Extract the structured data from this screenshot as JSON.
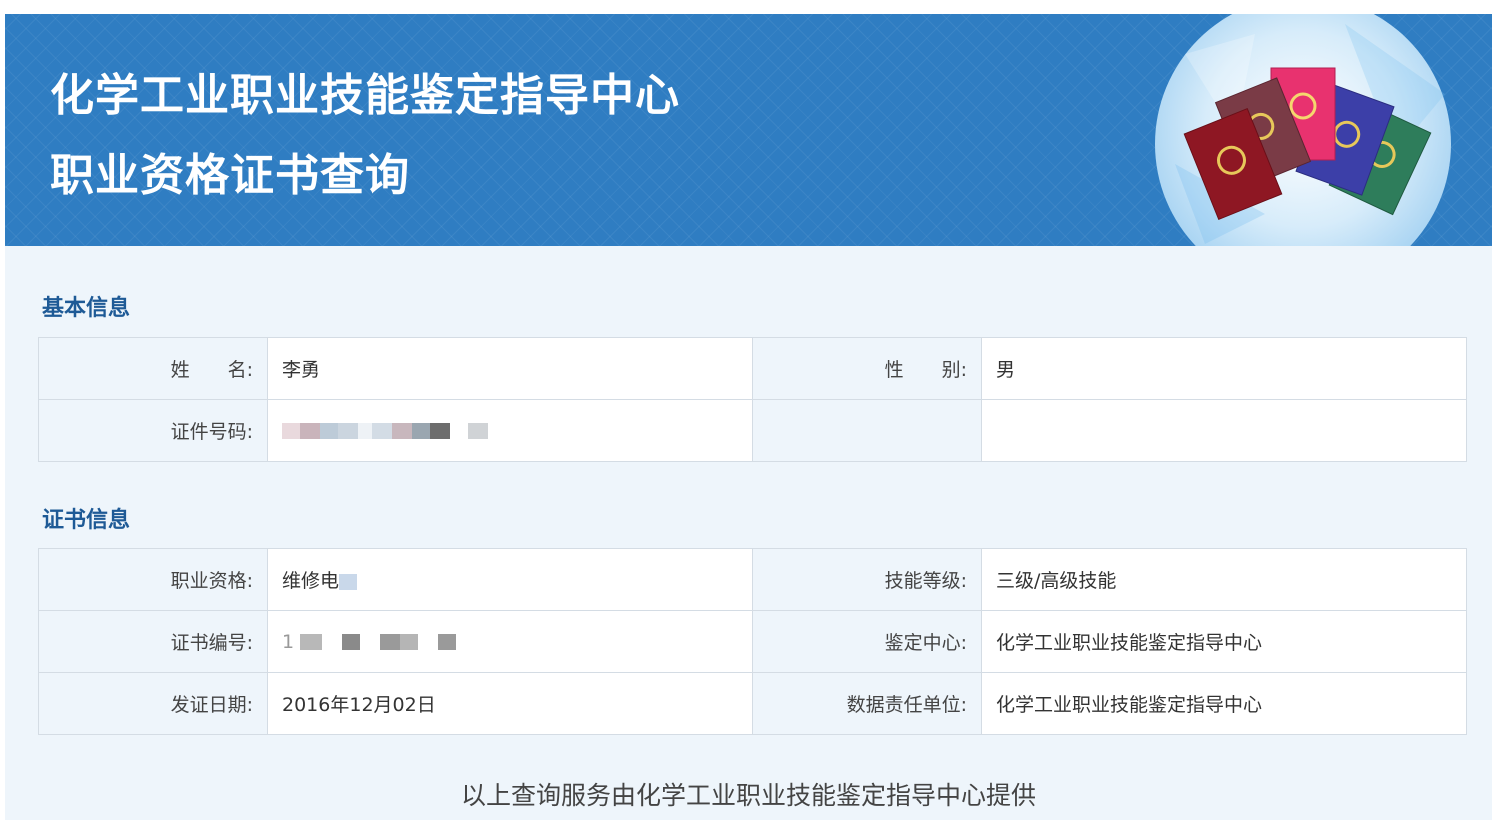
{
  "banner": {
    "title": "化学工业职业技能鉴定指导中心",
    "subtitle": "职业资格证书查询",
    "art_icon": "certificate-books-icon"
  },
  "basic": {
    "section_title": "基本信息",
    "name_label": "姓　　名:",
    "name_value": "李勇",
    "gender_label": "性　　别:",
    "gender_value": "男",
    "id_label": "证件号码:",
    "id_value": ""
  },
  "cert": {
    "section_title": "证书信息",
    "qualification_label": "职业资格:",
    "qualification_value": "维修电",
    "skill_level_label": "技能等级:",
    "skill_level_value": "三级/高级技能",
    "cert_no_label": "证书编号:",
    "cert_no_value": "1",
    "center_label": "鉴定中心:",
    "center_value": "化学工业职业技能鉴定指导中心",
    "issue_date_label": "发证日期:",
    "issue_date_value": "2016年12月02日",
    "responsible_label": "数据责任单位:",
    "responsible_value": "化学工业职业技能鉴定指导中心"
  },
  "footer": {
    "text": "以上查询服务由化学工业职业技能鉴定指导中心提供"
  },
  "colors": {
    "banner_blue": "#2f7dc2",
    "section_title": "#1e5a96",
    "label_bg": "#eef5fb",
    "border": "#d4dce4"
  }
}
